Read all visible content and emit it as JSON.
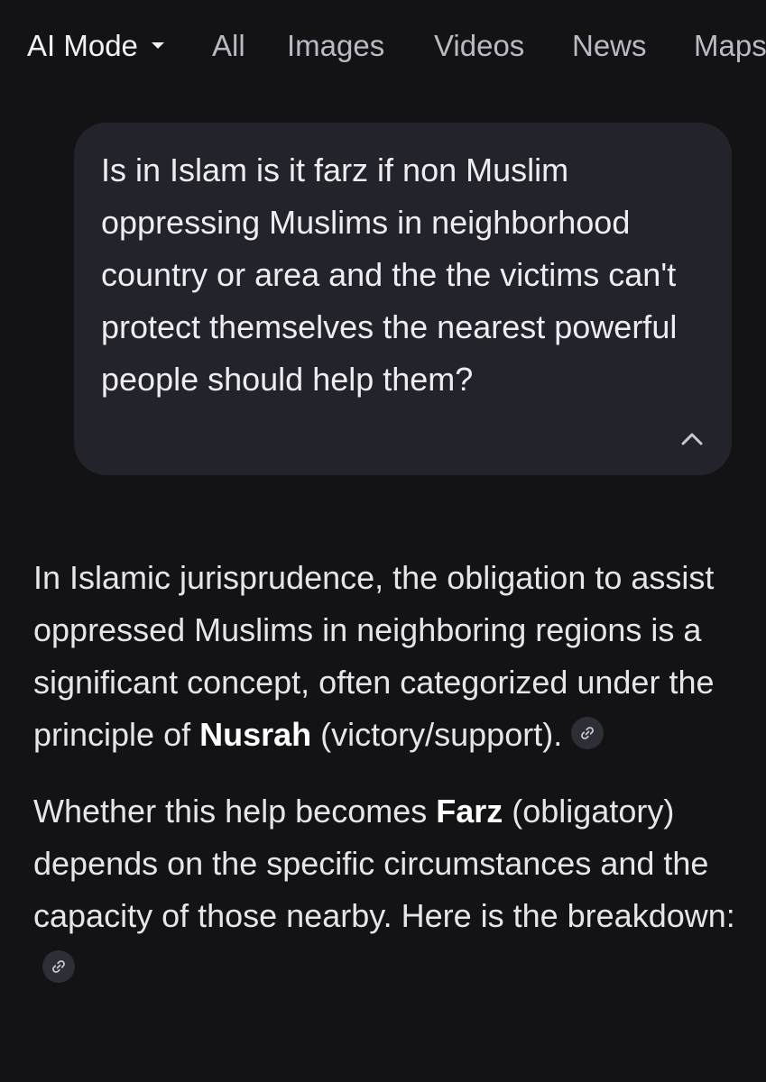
{
  "nav": {
    "tabs": [
      {
        "label": "AI Mode",
        "active": true
      },
      {
        "label": "All"
      },
      {
        "label": "Images"
      },
      {
        "label": "Videos"
      },
      {
        "label": "News"
      },
      {
        "label": "Maps"
      }
    ]
  },
  "query": {
    "text": "Is in Islam is it farz if non Muslim oppressing Muslims in neighborhood country or area and the the victims can't protect themselves the nearest powerful people should help them?",
    "collapse_icon": "chevron-up-icon"
  },
  "answer": {
    "p1": {
      "before": "In Islamic jurisprudence, the obligation to assist oppressed Muslims in neighboring regions is a significant concept, often categorized under the principle of ",
      "bold": "Nusrah",
      "after": " (victory/support).",
      "citation_icon": "link-icon"
    },
    "p2": {
      "before": "Whether this help becomes ",
      "bold": "Farz",
      "after": " (obligatory) depends on the specific circumstances and the capacity of those nearby. Here is the breakdown:",
      "citation_icon": "link-icon"
    }
  },
  "colors": {
    "background": "#131316",
    "bubble": "#23232b",
    "text": "#e6e6ea",
    "muted_tab": "#b9bac3"
  }
}
